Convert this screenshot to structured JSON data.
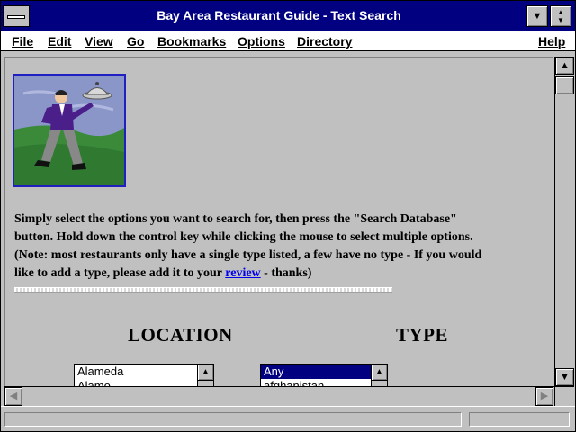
{
  "window": {
    "title": "Bay Area Restaurant Guide - Text Search"
  },
  "menu": {
    "items": [
      {
        "label": "File"
      },
      {
        "label": "Edit"
      },
      {
        "label": "View"
      },
      {
        "label": "Go"
      },
      {
        "label": "Bookmarks"
      },
      {
        "label": "Options"
      },
      {
        "label": "Directory"
      },
      {
        "label": "Help"
      }
    ]
  },
  "icons": {
    "system_menu": "system-menu-icon",
    "minimize": "down-triangle",
    "maximize": "up-down-triangle",
    "scroll_up": "up-arrow",
    "scroll_down": "down-arrow",
    "scroll_left": "left-arrow",
    "scroll_right": "right-arrow",
    "illustration": "waiter-with-tray"
  },
  "content": {
    "intro_line1": "Simply select the options you want to search for, then press the \"Search Database\"",
    "intro_line2": "button. Hold down the control key while clicking the mouse to select multiple options.",
    "intro_line3": "(Note: most restaurants only have a single type listed, a few have no type - If you would",
    "intro_line4_pre": "like to add a type, please add it to your ",
    "review_link": "review",
    "intro_line4_post": " - thanks)",
    "location_heading": "LOCATION",
    "type_heading": "TYPE",
    "location_options": [
      "Alameda",
      "Alamo"
    ],
    "type_options": [
      "Any",
      "afghanistan"
    ],
    "type_selected": "Any"
  },
  "colors": {
    "titlebar": "#000080",
    "link": "#0000ee",
    "selection": "#000080",
    "chrome": "#c0c0c0"
  }
}
